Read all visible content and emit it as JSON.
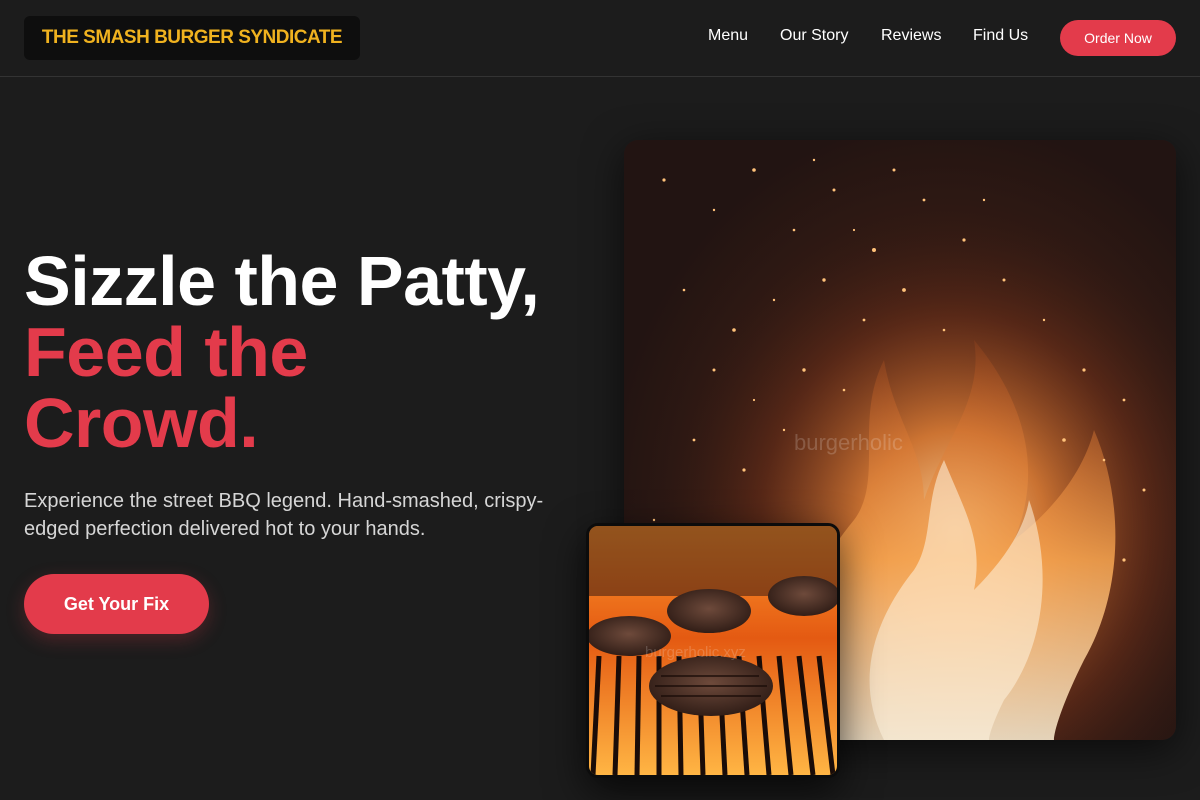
{
  "header": {
    "logo": "THE SMASH BURGER SYNDICATE",
    "nav": [
      "Menu",
      "Our Story",
      "Reviews",
      "Find Us"
    ],
    "order_button": "Order Now"
  },
  "hero": {
    "headline_line1": "Sizzle the Patty,",
    "headline_line2": "Feed the",
    "headline_line3": "Crowd.",
    "subcopy": "Experience the street BBQ legend. Hand-smashed, crispy-edged perfection delivered hot to your hands.",
    "cta": "Get Your Fix"
  },
  "images": {
    "fire_watermark": "burgerholic",
    "grill_watermark": "burgerholic.xyz"
  },
  "colors": {
    "background": "#1c1c1c",
    "accent": "#e33b4b",
    "logo_text": "#f0b21f"
  }
}
